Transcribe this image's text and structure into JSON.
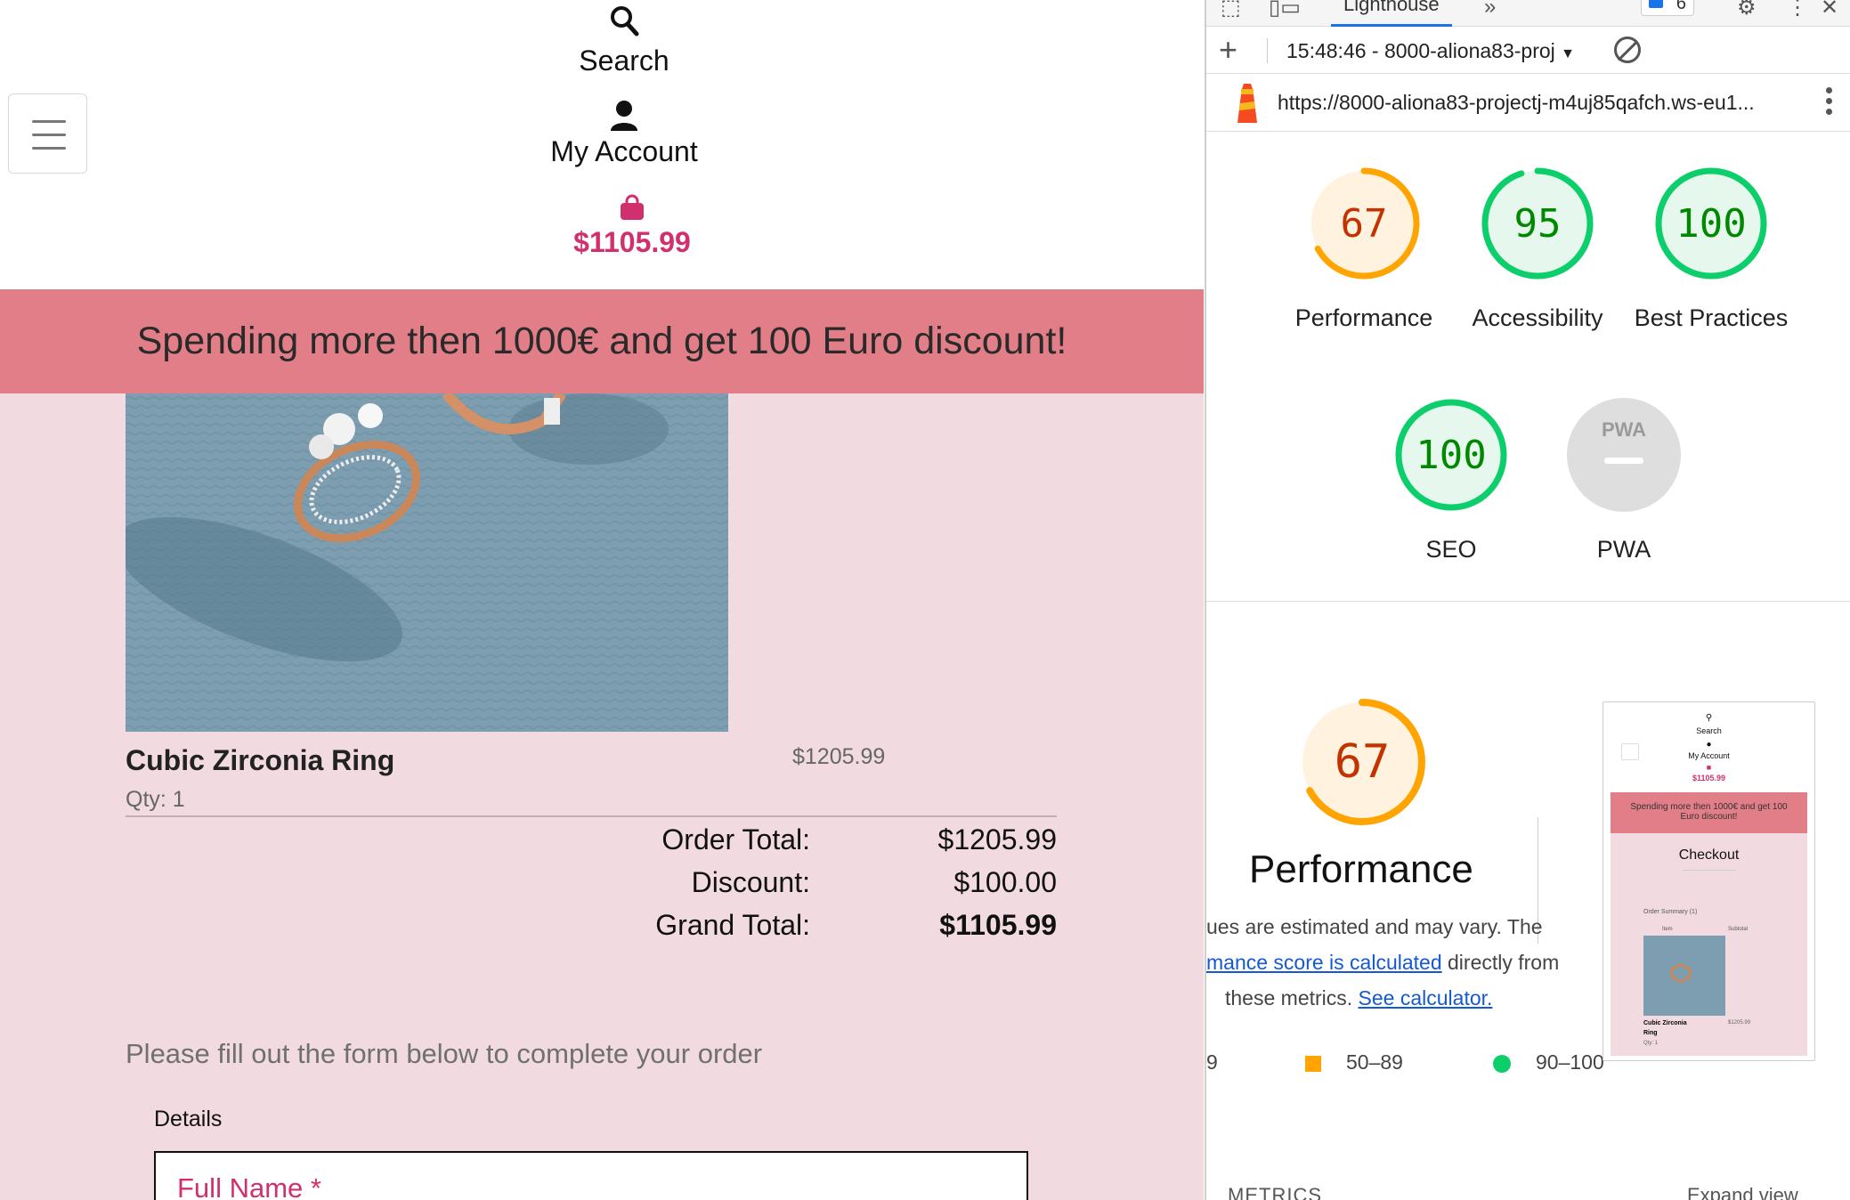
{
  "site": {
    "nav": {
      "search_label": "Search",
      "account_label": "My Account",
      "bag_total": "$1105.99"
    },
    "banner": "Spending more then 1000€ and get 100 Euro discount!",
    "product": {
      "name": "Cubic Zirconia Ring",
      "price": "$1205.99",
      "qty": "Qty: 1"
    },
    "totals": {
      "order_total_label": "Order Total:",
      "order_total": "$1205.99",
      "discount_label": "Discount:",
      "discount": "$100.00",
      "grand_total_label": "Grand Total:",
      "grand_total": "$1105.99"
    },
    "form": {
      "intro": "Please fill out the form below to complete your order",
      "details_legend": "Details",
      "full_name_placeholder": "Full Name *"
    },
    "colors": {
      "brand": "#d0306e",
      "banner": "#e27e87",
      "page_bg": "#f1dbe0"
    }
  },
  "devtools": {
    "tab": "Lighthouse",
    "badge_count": "6",
    "report_selector": "15:48:46 - 8000-aliona83-proj",
    "url": "https://8000-aliona83-projectj-m4uj85qafch.ws-eu1...",
    "scores": [
      {
        "label": "Performance",
        "value": "67",
        "score": 0.67,
        "color": "#e67700",
        "ring": "#ffa400"
      },
      {
        "label": "Accessibility",
        "value": "95",
        "score": 0.95,
        "color": "#008800",
        "ring": "#0cce6b"
      },
      {
        "label": "Best Practices",
        "value": "100",
        "score": 1.0,
        "color": "#008800",
        "ring": "#0cce6b"
      },
      {
        "label": "SEO",
        "value": "100",
        "score": 1.0,
        "color": "#008800",
        "ring": "#0cce6b"
      },
      {
        "label": "PWA",
        "value": "",
        "score": 0,
        "color": "#999999",
        "ring": "#cccccc"
      }
    ],
    "pwa_badge_text": "PWA",
    "performance": {
      "score": "67",
      "title": "Performance",
      "desc_line1": "ues are estimated and may vary. The",
      "desc_link1": "mance score is calculated",
      "desc_line2_rest": " directly from",
      "desc_line3": "these metrics. ",
      "desc_link2": "See calculator.",
      "legend_fail_partial": "9",
      "legend_average": "50–89",
      "legend_pass": "90–100"
    },
    "metrics_heading": "METRICS",
    "expand_view": "Expand view",
    "thumbnail": {
      "search": "Search",
      "account": "My Account",
      "total": "$1105.99",
      "banner": "Spending more then 1000€ and get 100 Euro discount!",
      "checkout": "Checkout",
      "order_summary": "Order Summary (1)",
      "item_col": "Item",
      "subtotal_col": "Subtotal",
      "product": "Cubic Zirconia Ring",
      "price": "$1205.99",
      "qty": "Qty: 1"
    }
  }
}
